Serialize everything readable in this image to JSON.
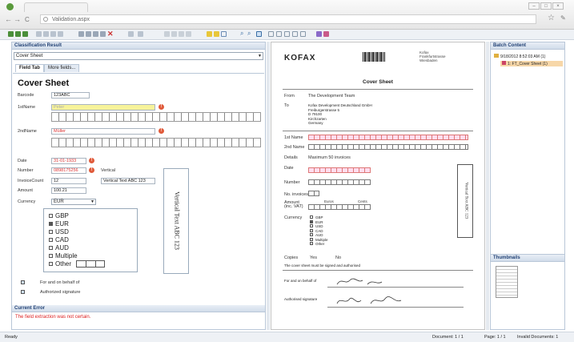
{
  "browser": {
    "url": "Validation.aspx"
  },
  "classification": {
    "header": "Classification Result",
    "selected": "Cover Sheet",
    "tabs": [
      "Field Tab",
      "More fields..."
    ]
  },
  "form": {
    "title": "Cover Sheet",
    "barcode_label": "Barcode",
    "barcode_value": "123ABC",
    "firstname_label": "1stName",
    "firstname_value": "Peter",
    "secondname_label": "2ndName",
    "secondname_value": "Müller",
    "date_label": "Date",
    "date_value": "31-01-1933",
    "number_label": "Number",
    "number_value": "0898175256",
    "invoicecount_label": "InvoiceCount",
    "invoicecount_value": "12",
    "amount_label": "Amount",
    "amount_value": "100.21",
    "currency_label": "Currency",
    "currency_value": "EUR",
    "vertical_label": "Vertical",
    "vertical_value": "Vertical Text ABC 123",
    "vertical_rotated": "Vertical Text ABC 123",
    "currency_options": [
      "GBP",
      "EUR",
      "USD",
      "CAD",
      "AUD",
      "Multiple",
      "Other"
    ],
    "behalf_label": "For and on behalf of",
    "signature_label": "Authorized signature"
  },
  "error": {
    "header": "Current Error",
    "message": "The field extraction was not certain."
  },
  "document": {
    "logo": "KOFAX",
    "address": [
      "Kofax",
      "Frankfurtstrasse",
      "Wiesbaden"
    ],
    "title": "Cover Sheet",
    "from_label": "From",
    "from_value": "The Development Team",
    "to_label": "To",
    "to_lines": [
      "Kofax Development Deutschland GmbH",
      "Freiburgerstrasse 5",
      "D 79100",
      "Kirchzarten",
      "Germany"
    ],
    "first_label": "1st Name",
    "second_label": "2nd Name",
    "details_label": "Details",
    "details_value": "Maximum 50 invoices",
    "date_label": "Date",
    "number_label": "Number",
    "invoices_label": "No. invoices",
    "amount_label": "Amount (inc. VAT)",
    "euros_label": "Euros",
    "cents_label": "Cents",
    "currency_label": "Currency",
    "currencies": [
      "GBP",
      "EUR",
      "USD",
      "CAD",
      "AUD",
      "Multiple",
      "Other"
    ],
    "copies_label": "Copies",
    "copies_yes": "Yes",
    "copies_no": "No",
    "sign_note": "The cover sheet must be signed and authorised",
    "behalf_label": "For and on behalf of",
    "signature_label": "Authorised signature",
    "vertical_text": "Vertical Text ABC 123"
  },
  "batch": {
    "header": "Batch Content",
    "root": "9/18/2012 8:52:03 AM (1)",
    "child": "1: FT_Cover Sheet (1)",
    "thumb_header": "Thumbnails"
  },
  "status": {
    "left": "Ready",
    "document": "Document: 1 / 1",
    "page": "Page: 1 / 1",
    "invalid": "Invalid Documents: 1"
  }
}
